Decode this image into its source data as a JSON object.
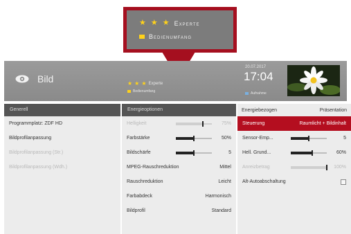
{
  "callout": {
    "level_label": "Experte",
    "scope_label": "Bedienumfang"
  },
  "header": {
    "title": "Bild",
    "level_label": "Experte",
    "scope_label": "Bedienumfang",
    "date": "20.07.2017",
    "time": "17:04",
    "recording_label": "Aufnahme"
  },
  "col1": {
    "header": "Generell",
    "items": [
      "Programmplatz: ZDF HD",
      "Bildprofilanpassung",
      "Bildprofilanpassung (Str.)",
      "Bildprofilanpassung (Wdh.)"
    ]
  },
  "col2": {
    "header": "Energieoptionen",
    "items": [
      {
        "label": "Helligkeit",
        "value": "75%",
        "level": 0.75,
        "dim": true
      },
      {
        "label": "Farbstärke",
        "value": "50%",
        "level": 0.5
      },
      {
        "label": "Bildschärfe",
        "value": "5",
        "level": 0.5
      },
      {
        "label": "MPEG-Rauschreduktion",
        "value": "Mittel"
      },
      {
        "label": "Rauschreduktion",
        "value": "Leicht"
      },
      {
        "label": "Farbabdeck",
        "value": "Harmonisch"
      },
      {
        "label": "Bildprofil",
        "value": "Standard"
      }
    ]
  },
  "col3": {
    "header_left": "Energiebezogen",
    "header_right": "Präsentation",
    "highlight_label": "Steuerung",
    "highlight_value": "Raumlicht + Bildinhalt",
    "items": [
      {
        "label": "Sensor-Emp...",
        "value": "5",
        "level": 0.5
      },
      {
        "label": "Hell. Grund...",
        "value": "60%",
        "level": 0.6
      },
      {
        "label": "Anreizbetrag",
        "value": "100%",
        "level": 1.0,
        "dim": true
      }
    ],
    "checkbox_label": "Alt-Autoabschaltung",
    "checkbox_checked": false
  },
  "colors": {
    "accent_red": "#b40e1f",
    "star_yellow": "#ffd21a",
    "header_grey": "#8f8f8f"
  },
  "icons": {
    "header_icon": "eye-icon",
    "level_icon": "star-icon",
    "scope_icon": "yellow-square-icon"
  }
}
